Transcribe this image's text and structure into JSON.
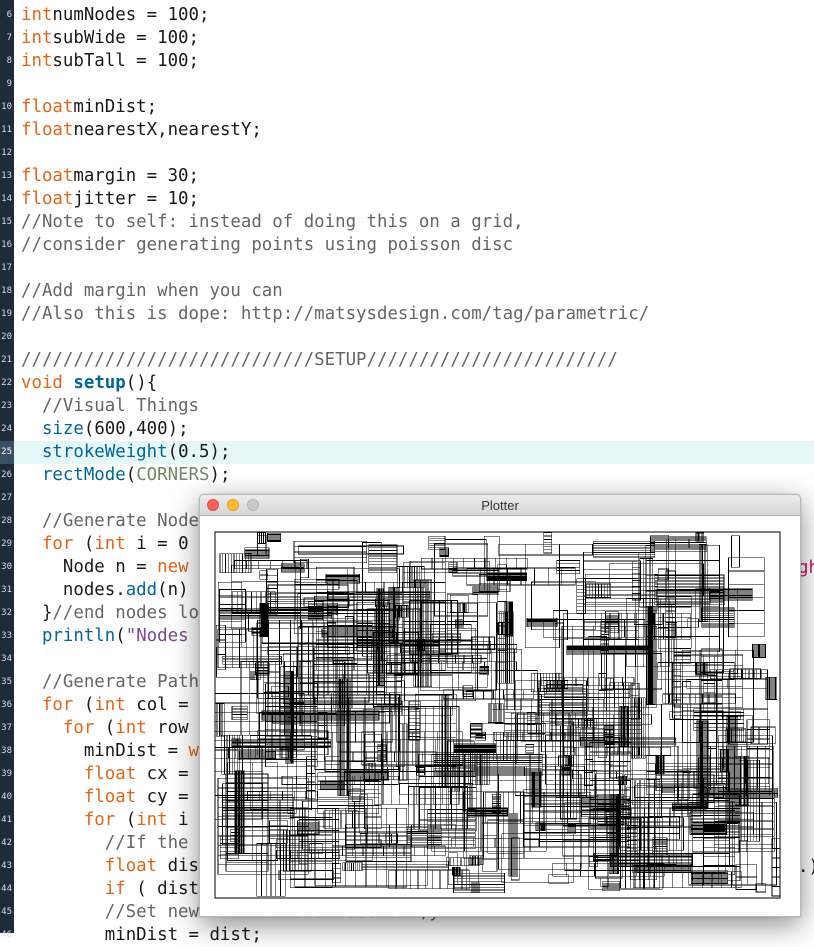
{
  "editor": {
    "lines": [
      {
        "n": "6",
        "t": [
          [
            "kw",
            "int"
          ],
          [
            "",
            "numNodes = 100;"
          ]
        ]
      },
      {
        "n": "7",
        "t": [
          [
            "kw",
            "int"
          ],
          [
            "",
            "subWide = 100;"
          ]
        ]
      },
      {
        "n": "8",
        "t": [
          [
            "kw",
            "int"
          ],
          [
            "",
            "subTall = 100;"
          ]
        ]
      },
      {
        "n": "9",
        "t": []
      },
      {
        "n": "10",
        "t": [
          [
            "kw",
            "float"
          ],
          [
            "",
            "minDist;"
          ]
        ]
      },
      {
        "n": "11",
        "t": [
          [
            "kw",
            "float"
          ],
          [
            "",
            "nearestX,nearestY;"
          ]
        ]
      },
      {
        "n": "12",
        "t": []
      },
      {
        "n": "13",
        "t": [
          [
            "kw",
            "float"
          ],
          [
            "",
            "margin = 30;"
          ]
        ]
      },
      {
        "n": "14",
        "t": [
          [
            "kw",
            "float"
          ],
          [
            "",
            "jitter = 10;"
          ]
        ]
      },
      {
        "n": "15",
        "t": [
          [
            "cm",
            "//Note to self: instead of doing this on a grid,"
          ]
        ]
      },
      {
        "n": "16",
        "t": [
          [
            "cm",
            "//consider generating points using poisson disc"
          ]
        ]
      },
      {
        "n": "17",
        "t": []
      },
      {
        "n": "18",
        "t": [
          [
            "cm",
            "//Add margin when you can"
          ]
        ]
      },
      {
        "n": "19",
        "t": [
          [
            "cm",
            "//Also this is dope: http://matsysdesign.com/tag/parametric/"
          ]
        ]
      },
      {
        "n": "20",
        "t": []
      },
      {
        "n": "21",
        "t": [
          [
            "cm",
            "////////////////////////////SETUP////////////////////////"
          ]
        ]
      },
      {
        "n": "22",
        "t": [
          [
            "kw",
            "void"
          ],
          [
            "",
            " "
          ],
          [
            "fnb",
            "setup"
          ],
          [
            "",
            "(){"
          ]
        ]
      },
      {
        "n": "23",
        "t": [
          [
            "",
            "  "
          ],
          [
            "cm",
            "//Visual Things"
          ]
        ]
      },
      {
        "n": "24",
        "t": [
          [
            "",
            "  "
          ],
          [
            "fn",
            "size"
          ],
          [
            "",
            "(600,400);"
          ]
        ]
      },
      {
        "n": "25",
        "t": [
          [
            "",
            "  "
          ],
          [
            "fn",
            "strokeWeight"
          ],
          [
            "",
            "(0.5);"
          ]
        ],
        "current": true
      },
      {
        "n": "26",
        "t": [
          [
            "",
            "  "
          ],
          [
            "fn",
            "rectMode"
          ],
          [
            "",
            "("
          ],
          [
            "const",
            "CORNERS"
          ],
          [
            "",
            ");"
          ]
        ]
      },
      {
        "n": "27",
        "t": []
      },
      {
        "n": "28",
        "t": [
          [
            "",
            "  "
          ],
          [
            "cm",
            "//Generate Node"
          ]
        ]
      },
      {
        "n": "29",
        "t": [
          [
            "",
            "  "
          ],
          [
            "kw",
            "for"
          ],
          [
            "",
            " ("
          ],
          [
            "kw",
            "int"
          ],
          [
            "",
            " i = 0"
          ]
        ]
      },
      {
        "n": "30",
        "t": [
          [
            "",
            "    Node n = "
          ],
          [
            "kw",
            "new"
          ]
        ]
      },
      {
        "n": "31",
        "t": [
          [
            "",
            "    nodes."
          ],
          [
            "fn",
            "add"
          ],
          [
            "",
            "(n)"
          ]
        ]
      },
      {
        "n": "32",
        "t": [
          [
            "",
            "  }"
          ],
          [
            "cm",
            "//end nodes lo"
          ]
        ]
      },
      {
        "n": "33",
        "t": [
          [
            "",
            "  "
          ],
          [
            "fn",
            "println"
          ],
          [
            "",
            "("
          ],
          [
            "st",
            "\"Nodes"
          ]
        ]
      },
      {
        "n": "34",
        "t": []
      },
      {
        "n": "35",
        "t": [
          [
            "",
            "  "
          ],
          [
            "cm",
            "//Generate Path"
          ]
        ]
      },
      {
        "n": "36",
        "t": [
          [
            "",
            "  "
          ],
          [
            "kw",
            "for"
          ],
          [
            "",
            " ("
          ],
          [
            "kw",
            "int"
          ],
          [
            "",
            " col ="
          ]
        ]
      },
      {
        "n": "37",
        "t": [
          [
            "",
            "    "
          ],
          [
            "kw",
            "for"
          ],
          [
            "",
            " ("
          ],
          [
            "kw",
            "int"
          ],
          [
            "",
            " row"
          ]
        ]
      },
      {
        "n": "38",
        "t": [
          [
            "",
            "      minDist = "
          ],
          [
            "kw",
            "w"
          ]
        ]
      },
      {
        "n": "39",
        "t": [
          [
            "",
            "      "
          ],
          [
            "kw",
            "float"
          ],
          [
            "",
            " cx ="
          ]
        ]
      },
      {
        "n": "40",
        "t": [
          [
            "",
            "      "
          ],
          [
            "kw",
            "float"
          ],
          [
            "",
            " cy ="
          ]
        ]
      },
      {
        "n": "41",
        "t": [
          [
            "",
            "      "
          ],
          [
            "kw",
            "for"
          ],
          [
            "",
            " ("
          ],
          [
            "kw",
            "int"
          ],
          [
            "",
            " i"
          ]
        ]
      },
      {
        "n": "42",
        "t": [
          [
            "",
            "        "
          ],
          [
            "cm",
            "//If the"
          ]
        ]
      },
      {
        "n": "43",
        "t": [
          [
            "",
            "        "
          ],
          [
            "kw",
            "float"
          ],
          [
            "",
            " dis"
          ]
        ]
      },
      {
        "n": "44",
        "t": [
          [
            "",
            "        "
          ],
          [
            "kw",
            "if"
          ],
          [
            "",
            " ( dist"
          ]
        ]
      },
      {
        "n": "45",
        "t": [
          [
            "",
            "        "
          ],
          [
            "cm",
            "//Set new minimum and record x,y"
          ]
        ]
      },
      {
        "n": "46",
        "t": [
          [
            "",
            "        minDist = dist;"
          ]
        ]
      }
    ],
    "offscreen_right_a": "gh",
    "offscreen_right_b": ".)"
  },
  "plotter": {
    "title": "Plotter",
    "canvas_size": "600×400"
  }
}
